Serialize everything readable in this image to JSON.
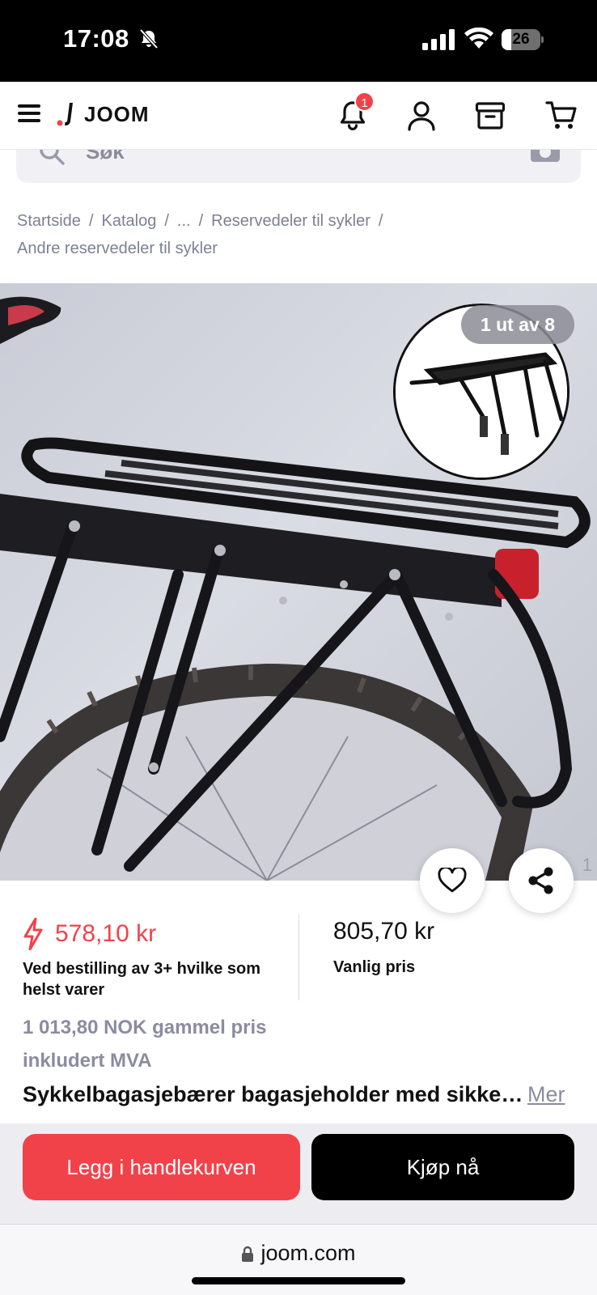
{
  "status_bar": {
    "time": "17:08",
    "battery_level": "26",
    "battery_fraction": 0.26
  },
  "header": {
    "logo_text": "JOOM",
    "notification_count": "1",
    "icons": [
      "menu-icon",
      "bell-icon",
      "user-icon",
      "orders-box-icon",
      "cart-icon"
    ]
  },
  "search": {
    "placeholder": "Søk"
  },
  "breadcrumb": {
    "items": [
      "Startside",
      "Katalog",
      "...",
      "Reservedeler til sykler",
      "Andre reservedeler til sykler"
    ],
    "separator": "/"
  },
  "gallery": {
    "counter": "1 ut av 8",
    "page_number": "1"
  },
  "pricing": {
    "promo_price": "578,10 kr",
    "promo_description": "Ved bestilling av 3+ hvilke som helst varer",
    "regular_price": "805,70 kr",
    "regular_label": "Vanlig pris",
    "old_price": "1 013,80 NOK gammel pris",
    "vat_note": "inkludert MVA",
    "accent_color": "#f1424a"
  },
  "product": {
    "title": "Sykkelbagasjebærer bagasjeholder med sikkerhetsrefleks",
    "more_label": "Mer"
  },
  "actions": {
    "add_to_cart": "Legg i handlekurven",
    "buy_now": "Kjøp nå"
  },
  "browser": {
    "url": "joom.com"
  }
}
